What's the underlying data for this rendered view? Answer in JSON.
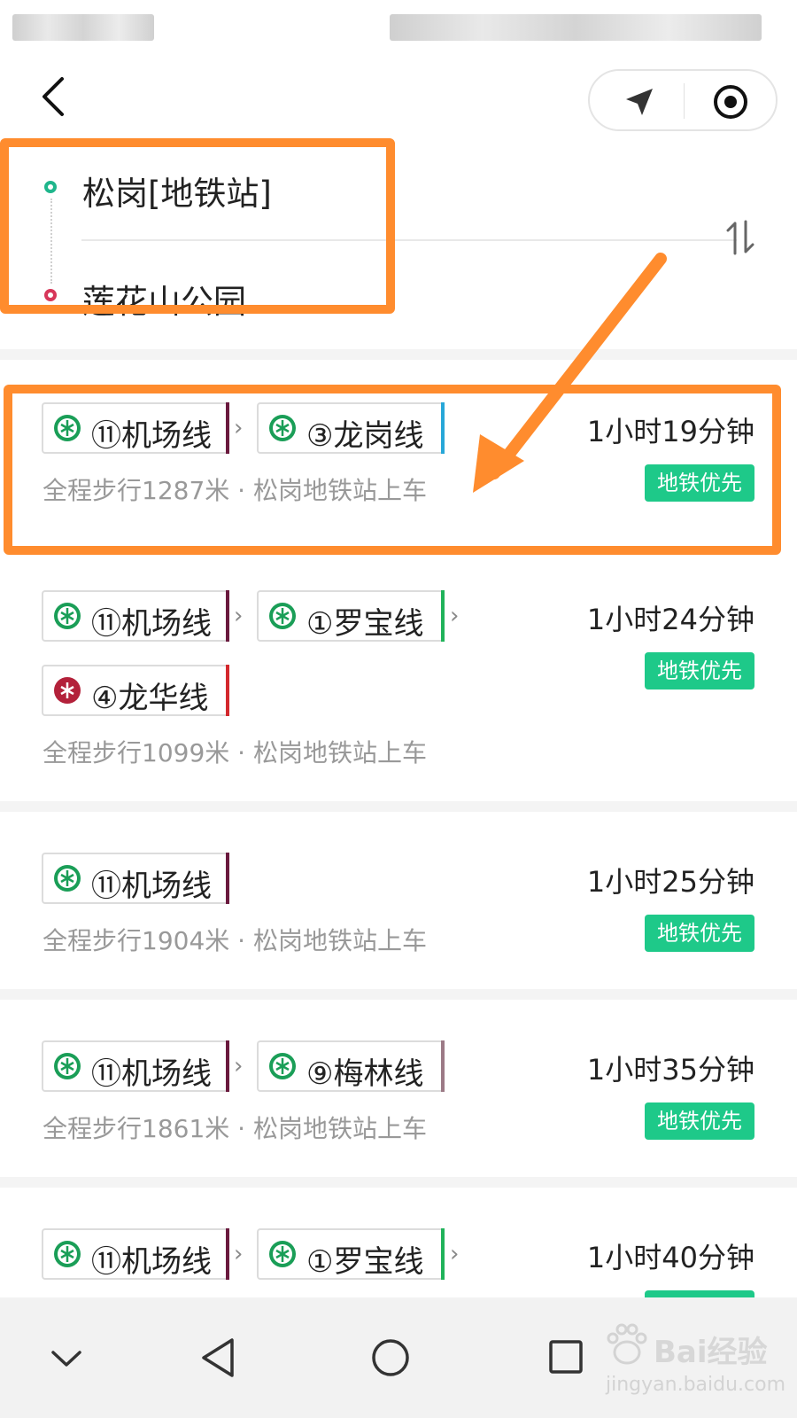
{
  "header": {
    "back_icon": "back-arrow-icon",
    "navigate_icon": "navigate-arrow-icon",
    "locate_icon": "locate-target-icon"
  },
  "route_input": {
    "start": "松岗[地铁站]",
    "end": "莲花山公园",
    "swap_icon": "swap-vertical-icon"
  },
  "colors": {
    "highlight": "#ff8c2e",
    "tag_bg": "#1ec989",
    "start_dot": "#1fb68c",
    "end_dot": "#d7375a",
    "line_11": "#6a1a3e",
    "line_3": "#27a7d8",
    "line_1": "#20b35a",
    "line_4": "#d3282d",
    "line_9": "#9c7a86"
  },
  "routes": [
    {
      "lines": [
        {
          "label": "⑪机场线"
        },
        {
          "label": "③龙岗线"
        }
      ],
      "duration": "1小时19分钟",
      "tag": "地铁优先",
      "desc": "全程步行1287米 · 松岗地铁站上车"
    },
    {
      "lines": [
        {
          "label": "⑪机场线"
        },
        {
          "label": "①罗宝线"
        },
        {
          "label": "④龙华线"
        }
      ],
      "duration": "1小时24分钟",
      "tag": "地铁优先",
      "desc": "全程步行1099米 · 松岗地铁站上车"
    },
    {
      "lines": [
        {
          "label": "⑪机场线"
        }
      ],
      "duration": "1小时25分钟",
      "tag": "地铁优先",
      "desc": "全程步行1904米 · 松岗地铁站上车"
    },
    {
      "lines": [
        {
          "label": "⑪机场线"
        },
        {
          "label": "⑨梅林线"
        }
      ],
      "duration": "1小时35分钟",
      "tag": "地铁优先",
      "desc": "全程步行1861米 · 松岗地铁站上车"
    },
    {
      "lines": [
        {
          "label": "⑪机场线"
        },
        {
          "label": "①罗宝线"
        }
      ],
      "duration": "1小时40分钟",
      "tag": "地铁优先",
      "desc": ""
    }
  ],
  "navbar": {
    "items": [
      "chevron-down-icon",
      "back-triangle-icon",
      "home-circle-icon",
      "recents-square-icon"
    ]
  },
  "watermark": {
    "logo": "Bai经验",
    "sub": "jingyan.baidu.com"
  }
}
